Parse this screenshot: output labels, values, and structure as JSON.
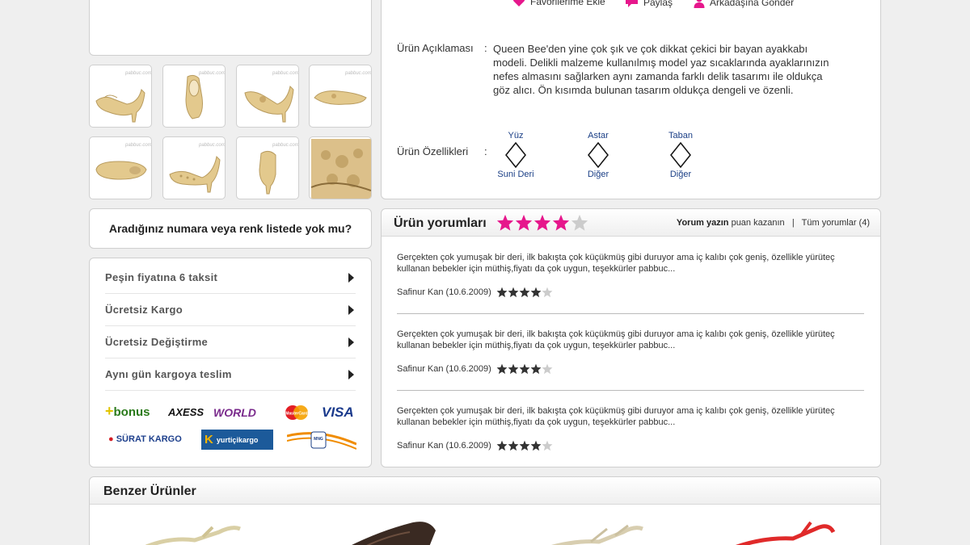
{
  "actions": {
    "favorites": "Favorilerime Ekle",
    "share": "Paylaş",
    "send_friend": "Arkadaşına Gönder"
  },
  "product": {
    "description_label": "Ürün Açıklaması",
    "colon": ":",
    "description": "Queen Bee'den yine çok şık ve çok dikkat çekici bir bayan ayakkabı modeli. Delikli malzeme kullanılmış model yaz sıcaklarında ayaklarınızın nefes almasını sağlarken aynı zamanda farklı delik tasarımı ile oldukça göz alıcı. Ön kısımda bulunan tasarım oldukça dengeli ve özenli.",
    "features_label": "Ürün Özellikleri",
    "features": [
      {
        "title": "Yüz",
        "value": "Suni Deri"
      },
      {
        "title": "Astar",
        "value": "Diğer"
      },
      {
        "title": "Taban",
        "value": "Diğer"
      }
    ]
  },
  "gallery": {
    "watermark": "pabbuc.com",
    "watermark_small": "www.pabbuc.com"
  },
  "question": "Aradığınız numara veya renk listede yok mu?",
  "services": [
    "Peşin fiyatına 6 taksit",
    "Ücretsiz Kargo",
    "Ücretsiz Değiştirme",
    "Aynı gün kargoya teslim"
  ],
  "logos": {
    "bonus": "bonus",
    "axess": "AXESS",
    "world": "WORLD",
    "mastercard": "MasterCard",
    "visa": "VISA",
    "surat": "SÜRAT KARGO",
    "yurtici": "yurtiçikargo",
    "mng": "MNG"
  },
  "reviews": {
    "title": "Ürün yorumları",
    "rating": 4,
    "max_rating": 5,
    "write_bold": "Yorum yazın",
    "write_rest": " puan kazanın",
    "divider": "|",
    "all": "Tüm yorumlar (4)",
    "items": [
      {
        "text": "Gerçekten çok yumuşak bir deri, ilk bakışta çok küçükmüş gibi duruyor ama iç kalıbı çok geniş, özellikle yürüteç kullanan bebekler için müthiş,fiyatı da çok uygun, teşekkürler pabbuc...",
        "author": "Safinur Kan (10.6.2009)",
        "rating": 4
      },
      {
        "text": "Gerçekten çok yumuşak bir deri, ilk bakışta çok küçükmüş gibi duruyor ama iç kalıbı çok geniş, özellikle yürüteç kullanan bebekler için müthiş,fiyatı da çok uygun, teşekkürler pabbuc...",
        "author": "Safinur Kan (10.6.2009)",
        "rating": 4
      },
      {
        "text": "Gerçekten çok yumuşak bir deri, ilk bakışta çok küçükmüş gibi duruyor ama iç kalıbı çok geniş, özellikle yürüteç kullanan bebekler için müthiş,fiyatı da çok uygun, teşekkürler pabbuc...",
        "author": "Safinur Kan (10.6.2009)",
        "rating": 4
      }
    ]
  },
  "similar": {
    "title": "Benzer Ürünler"
  },
  "colors": {
    "accent_pink": "#e6178c",
    "feature_blue": "#1b3f86",
    "star_dark": "#333333",
    "star_empty": "#cccccc"
  }
}
